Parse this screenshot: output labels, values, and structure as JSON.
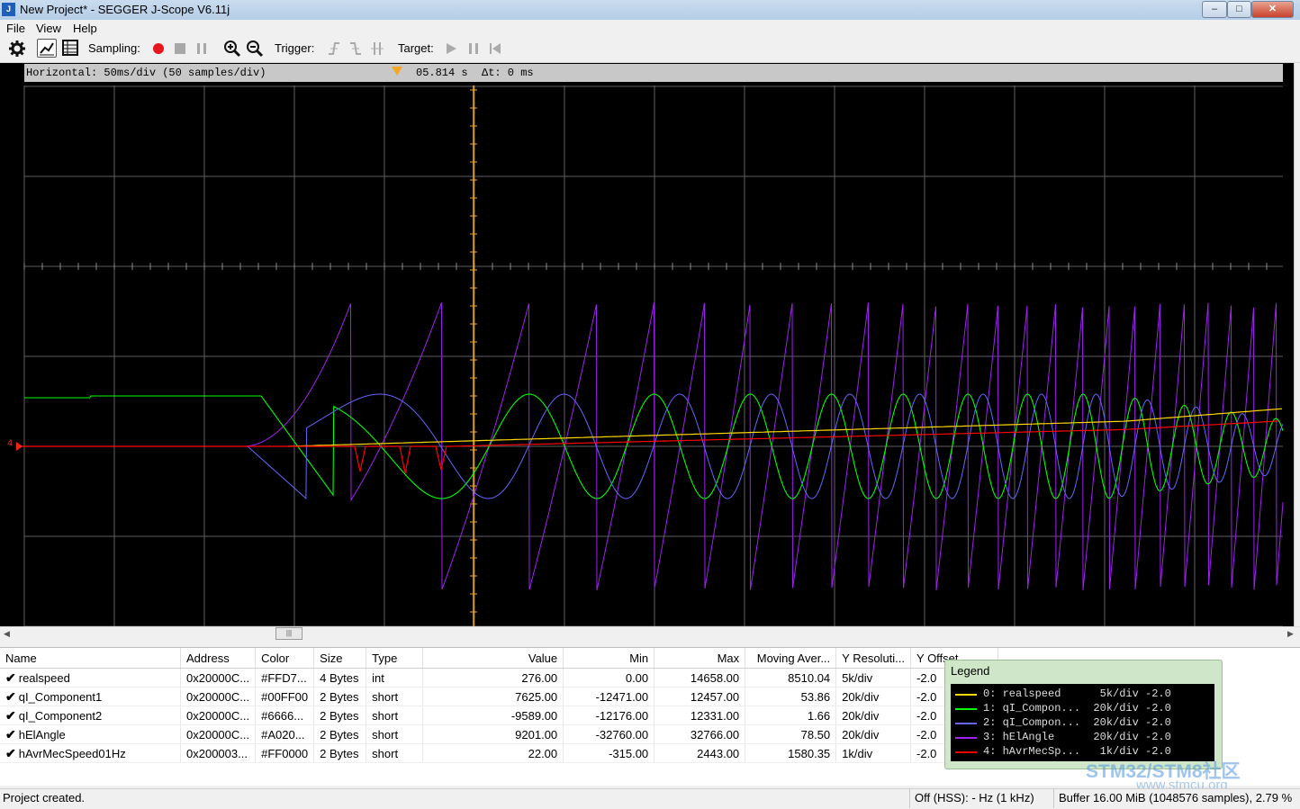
{
  "window": {
    "title": "New Project* - SEGGER J-Scope V6.11j",
    "app_icon": "J",
    "minimize": "‒",
    "maximize": "□",
    "close": "✕"
  },
  "menu": [
    {
      "label": "File"
    },
    {
      "label": "View"
    },
    {
      "label": "Help"
    }
  ],
  "toolbar": {
    "sampling_label": "Sampling:",
    "trigger_label": "Trigger:",
    "target_label": "Target:",
    "icons": [
      "gear-icon",
      "line-chart-icon",
      "table-icon",
      "record-icon",
      "stop-icon",
      "pause-icon",
      "zoom-in-icon",
      "zoom-out-icon",
      "trigger-rising-icon",
      "trigger-falling-icon",
      "trigger-both-icon",
      "play-icon",
      "pause-target-icon",
      "step-back-icon"
    ]
  },
  "scope": {
    "horizontal": "Horizontal: 50ms/div (50 samples/div)",
    "cursor_time": "05.814 s",
    "delta_t": "Δt: 0 ms",
    "zero_marker": "4",
    "background": "#000000",
    "grid_color": "#606060"
  },
  "channels_table": {
    "columns": [
      "Name",
      "Address",
      "Color",
      "Size",
      "Type",
      "Value",
      "Min",
      "Max",
      "Moving Aver...",
      "Y Resoluti...",
      "Y Offset"
    ],
    "rows": [
      {
        "name": "realspeed",
        "address": "0x20000C...",
        "color": "#FFD7...",
        "size": "4 Bytes",
        "type": "int",
        "value": "276.00",
        "min": "0.00",
        "max": "14658.00",
        "avg": "8510.04",
        "yres": "5k/div",
        "yoff": "-2.0"
      },
      {
        "name": "qI_Component1",
        "address": "0x20000C...",
        "color": "#00FF00",
        "size": "2 Bytes",
        "type": "short",
        "value": "7625.00",
        "min": "-12471.00",
        "max": "12457.00",
        "avg": "53.86",
        "yres": "20k/div",
        "yoff": "-2.0"
      },
      {
        "name": "qI_Component2",
        "address": "0x20000C...",
        "color": "#6666...",
        "size": "2 Bytes",
        "type": "short",
        "value": "-9589.00",
        "min": "-12176.00",
        "max": "12331.00",
        "avg": "1.66",
        "yres": "20k/div",
        "yoff": "-2.0"
      },
      {
        "name": "hElAngle",
        "address": "0x20000C...",
        "color": "#A020...",
        "size": "2 Bytes",
        "type": "short",
        "value": "9201.00",
        "min": "-32760.00",
        "max": "32766.00",
        "avg": "78.50",
        "yres": "20k/div",
        "yoff": "-2.0"
      },
      {
        "name": "hAvrMecSpeed01Hz",
        "address": "0x200003...",
        "color": "#FF0000",
        "size": "2 Bytes",
        "type": "short",
        "value": "22.00",
        "min": "-315.00",
        "max": "2443.00",
        "avg": "1580.35",
        "yres": "1k/div",
        "yoff": "-2.0"
      }
    ]
  },
  "legend": {
    "title": "Legend",
    "entries": [
      {
        "text": "0: realspeed      5k/div -2.0",
        "color": "#FFD700"
      },
      {
        "text": "1: qI_Compon...  20k/div -2.0",
        "color": "#00FF00"
      },
      {
        "text": "2: qI_Compon...  20k/div -2.0",
        "color": "#6666FF"
      },
      {
        "text": "3: hElAngle      20k/div -2.0",
        "color": "#A020F0"
      },
      {
        "text": "4: hAvrMecSp...   1k/div -2.0",
        "color": "#FF0000"
      }
    ]
  },
  "status": {
    "message": "Project created.",
    "hss": "Off (HSS): - Hz (1 kHz)",
    "buffer": "Buffer 16.00 MiB (1048576 samples), 2.79 %"
  },
  "watermark": {
    "line1": "STM32/STM8社区",
    "line2": "www.stmcu.org"
  }
}
